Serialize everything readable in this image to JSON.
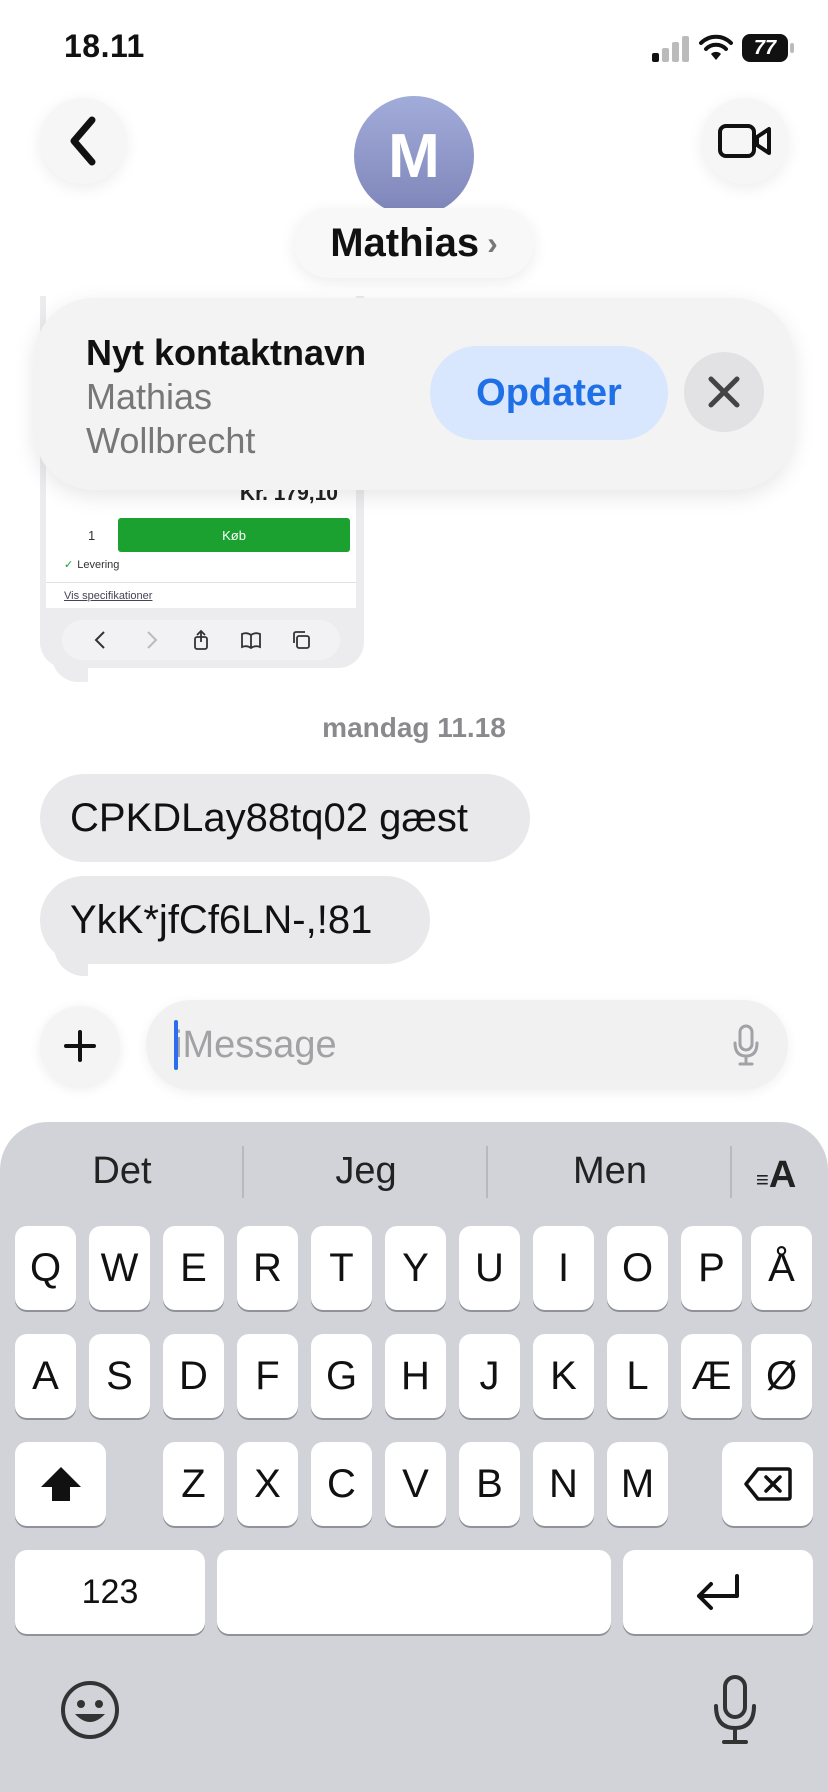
{
  "status_bar": {
    "time": "18.11",
    "battery": "77",
    "signal_icon": "cellular-signal-icon",
    "wifi_icon": "wifi-icon"
  },
  "header": {
    "avatar_initial": "M",
    "contact_name": "Mathias",
    "chevron": "›",
    "back_icon": "chevron-left-icon",
    "video_icon": "video-camera-icon"
  },
  "shared_image": {
    "price": "Kr. 179,10",
    "quantity": "1",
    "buy_label": "Køb",
    "delivery_label": "Levering",
    "specs_link": "Vis specifikationer"
  },
  "banner": {
    "title": "Nyt kontaktnavn",
    "name_line_1": "Mathias",
    "name_line_2": "Wollbrecht",
    "update_label": "Opdater",
    "close_icon": "close-x-icon"
  },
  "conversation": {
    "timestamp": "mandag 11.18",
    "messages": [
      {
        "text": "CPKDLay88tq02 gæst"
      },
      {
        "text": "YkK*jfCf6LN-,!81"
      }
    ]
  },
  "composer": {
    "placeholder": "iMessage",
    "plus_icon": "plus-icon",
    "mic_icon": "microphone-icon"
  },
  "keyboard": {
    "suggestions": [
      "Det",
      "Jeg",
      "Men"
    ],
    "format_label": "A",
    "rows": [
      [
        "Q",
        "W",
        "E",
        "R",
        "T",
        "Y",
        "U",
        "I",
        "O",
        "P",
        "Å"
      ],
      [
        "A",
        "S",
        "D",
        "F",
        "G",
        "H",
        "J",
        "K",
        "L",
        "Æ",
        "Ø"
      ],
      [
        "Z",
        "X",
        "C",
        "V",
        "B",
        "N",
        "M"
      ]
    ],
    "numbers_label": "123",
    "shift_icon": "shift-arrow-icon",
    "delete_icon": "backspace-icon",
    "return_icon": "return-arrow-icon",
    "emoji_icon": "emoji-face-icon",
    "dictation_icon": "microphone-icon"
  }
}
